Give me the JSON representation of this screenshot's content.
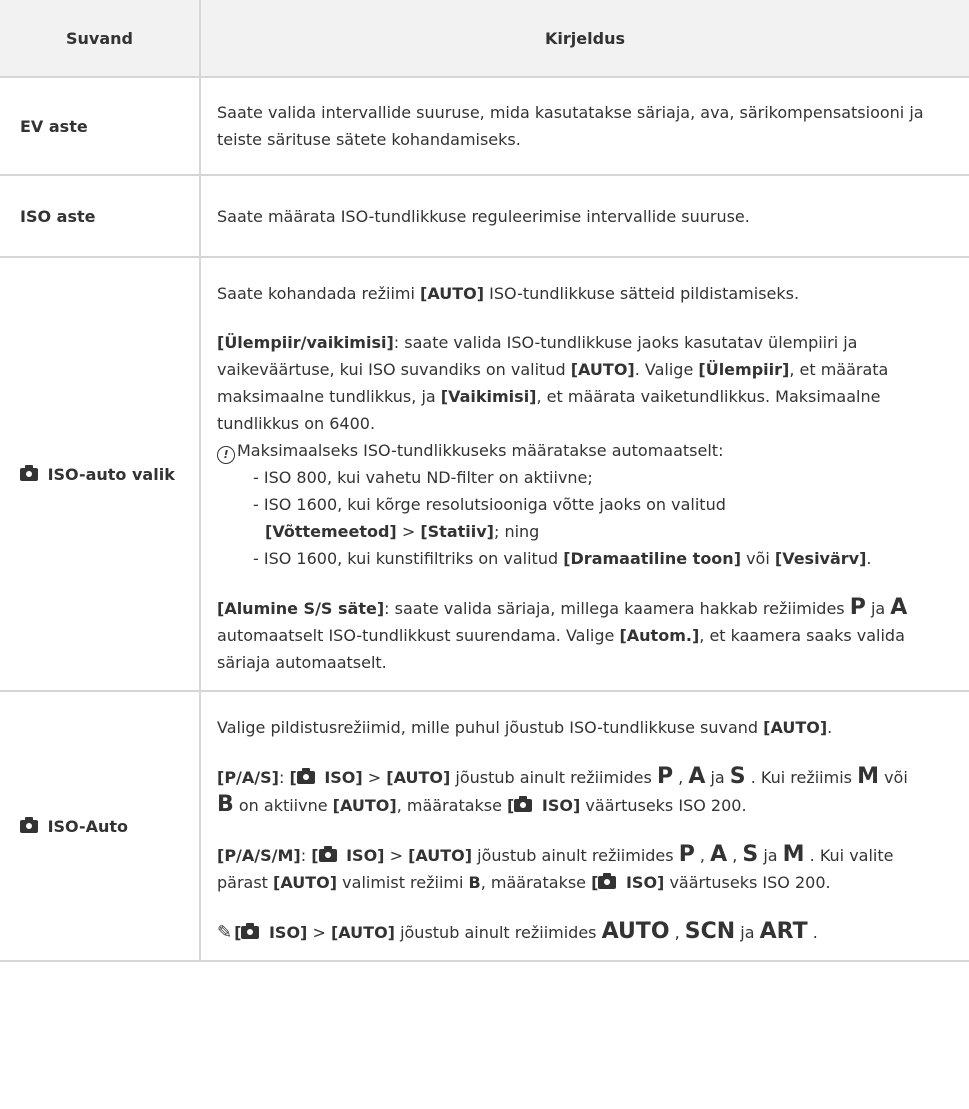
{
  "header": {
    "col_option": "Suvand",
    "col_description": "Kirjeldus"
  },
  "rows": [
    {
      "option": "EV aste",
      "description": "Saate valida intervallide suuruse, mida kasutatakse säriaja, ava, särikompensatsiooni ja teiste särituse sätete kohandamiseks."
    },
    {
      "option": "ISO aste",
      "description": "Saate määrata ISO-tundlikkuse reguleerimise intervallide suuruse."
    },
    {
      "option": "ISO-auto valik",
      "p1": {
        "a": "Saate kohandada režiimi ",
        "b": "[AUTO]",
        "c": " ISO-tundlikkuse sätteid pildistamiseks."
      },
      "p2": {
        "a": "[Ülempiir/vaikimisi]",
        "b": ": saate valida ISO-tundlikkuse jaoks kasutatav ülempiiri ja vaikeväärtuse, kui ISO suvandiks on valitud ",
        "c": "[AUTO]",
        "d": ". Valige ",
        "e": "[Ülempiir]",
        "f": ", et määrata maksimaalne tundlikkus, ja ",
        "g": "[Vaikimisi]",
        "h": ", et määrata vaiketundlikkus. Maksimaalne tundlikkus on 6400."
      },
      "note": "Maksimaalseks ISO-tundlikkuseks määratakse automaatselt:",
      "list": {
        "i1": "- ISO 800, kui vahetu ND-filter on aktiivne;",
        "i2a": "- ISO 1600, kui kõrge resolutsiooniga võtte jaoks on valitud",
        "i2b": "[Võttemeetod]",
        "i2c": " > ",
        "i2d": "[Statiiv]",
        "i2e": "; ning",
        "i3a": "- ISO 1600, kui kunstifiltriks on valitud ",
        "i3b": "[Dramaatiline toon]",
        "i3c": " või ",
        "i3d": "[Vesivärv]",
        "i3e": "."
      },
      "p3": {
        "a": "[Alumine S/S säte]",
        "b": ": saate valida säriaja, millega kaamera hakkab režiimides ",
        "m1": "P",
        "c": " ja ",
        "m2": "A",
        "d": " automaatselt ISO-tundlikkust suurendama. Valige ",
        "e": "[Autom.]",
        "f": ", et kaamera saaks valida säriaja automaatselt."
      }
    },
    {
      "option": "ISO-Auto",
      "p1": {
        "a": "Valige pildistusrežiimid, mille puhul jõustub ISO-tundlikkuse suvand ",
        "b": "[AUTO]",
        "c": "."
      },
      "p2": {
        "a": "[P/A/S]",
        "b": ": ",
        "c": "[",
        "d": " ISO]",
        "e": " > ",
        "f": "[AUTO]",
        "g": " jõustub ainult režiimides ",
        "m1": "P",
        "h": " , ",
        "m2": "A",
        "i": " ja ",
        "m3": "S",
        "j": " . Kui režiimis ",
        "m4": "M",
        "k": " või ",
        "m5": "B",
        "l": " on aktiivne ",
        "n": "[AUTO]",
        "o": ", määratakse ",
        "p": "[",
        "q": " ISO]",
        "r": " väärtuseks ISO 200."
      },
      "p3": {
        "a": "[P/A/S/M]",
        "b": ": ",
        "c": "[",
        "d": " ISO]",
        "e": " > ",
        "f": "[AUTO]",
        "g": " jõustub ainult režiimides ",
        "m1": "P",
        "h": " , ",
        "m2": "A",
        "i": " , ",
        "m3": "S",
        "j": " ja ",
        "m4": "M",
        "k": " . Kui valite pärast ",
        "l": "[AUTO]",
        "n": " valimist režiimi ",
        "o": "B",
        "p": ", määratakse ",
        "q": "[",
        "r": " ISO]",
        "s": " väärtuseks ISO 200."
      },
      "p4": {
        "a": "[",
        "b": " ISO]",
        "c": " > ",
        "d": "[AUTO]",
        "e": " jõustub ainult režiimides ",
        "m1": "AUTO",
        "f": " , ",
        "m2": "SCN",
        "g": " ja ",
        "m3": "ART",
        "h": " ."
      }
    }
  ],
  "icons": {
    "camera": "camera-icon",
    "note": "caution-note-icon",
    "tip": "tip-pen-icon"
  }
}
